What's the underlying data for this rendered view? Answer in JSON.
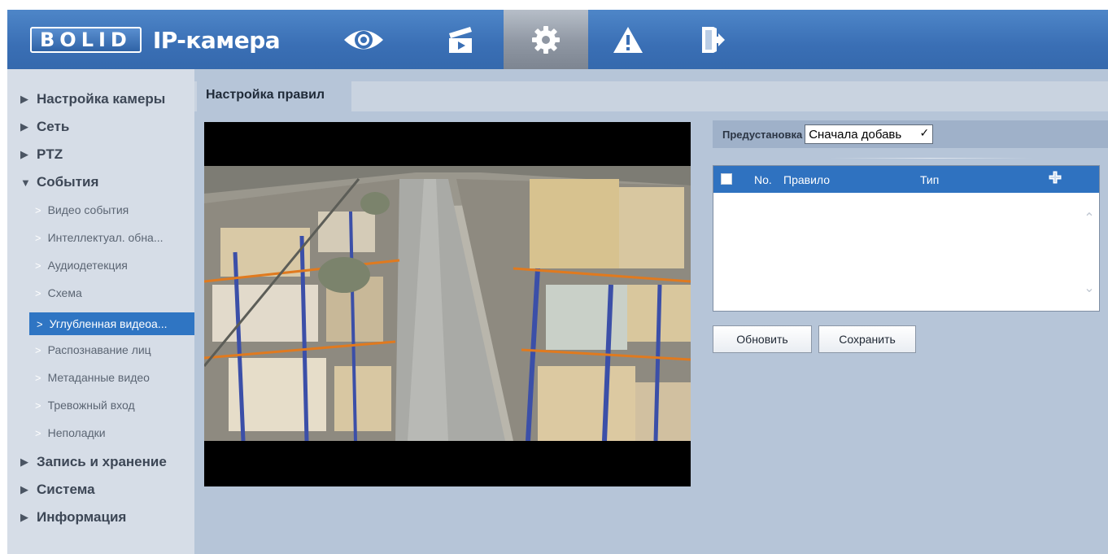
{
  "header": {
    "logo_text": "BOLID",
    "title": "IP-камера",
    "nav": [
      {
        "icon": "eye-icon",
        "name": "live"
      },
      {
        "icon": "clapperboard-icon",
        "name": "playback"
      },
      {
        "icon": "gear-icon",
        "name": "setup",
        "active": true
      },
      {
        "icon": "warning-icon",
        "name": "alarm"
      },
      {
        "icon": "logout-icon",
        "name": "logout"
      }
    ]
  },
  "sidebar": {
    "items": [
      {
        "label": "Настройка камеры",
        "level": 1,
        "expanded": false
      },
      {
        "label": "Сеть",
        "level": 1,
        "expanded": false
      },
      {
        "label": "PTZ",
        "level": 1,
        "expanded": false
      },
      {
        "label": "События",
        "level": 1,
        "expanded": true
      },
      {
        "label": "Видео события",
        "level": 2
      },
      {
        "label": "Интеллектуал. обна...",
        "level": 2
      },
      {
        "label": "Аудиодетекция",
        "level": 2
      },
      {
        "label": "Схема",
        "level": 2
      },
      {
        "label": "Углубленная видеоа...",
        "level": 2,
        "active": true
      },
      {
        "label": "Распознавание лиц",
        "level": 2
      },
      {
        "label": "Метаданные видео",
        "level": 2
      },
      {
        "label": "Тревожный вход",
        "level": 2
      },
      {
        "label": "Неполадки",
        "level": 2
      },
      {
        "label": "Запись и хранение",
        "level": 1,
        "expanded": false
      },
      {
        "label": "Система",
        "level": 1,
        "expanded": false
      },
      {
        "label": "Информация",
        "level": 1,
        "expanded": false
      }
    ]
  },
  "main": {
    "tab_label": "Настройка правил",
    "preset_label": "Предустановка",
    "preset_value": "Сначала добавь",
    "table": {
      "columns": [
        "No.",
        "Правило",
        "Тип"
      ],
      "rows": []
    },
    "buttons": {
      "refresh": "Обновить",
      "save": "Сохранить"
    }
  },
  "colors": {
    "header_blue": "#3a6fb5",
    "sidebar_bg": "#d6dde7",
    "content_bg": "#b6c5d8",
    "accent": "#2f75c3"
  }
}
